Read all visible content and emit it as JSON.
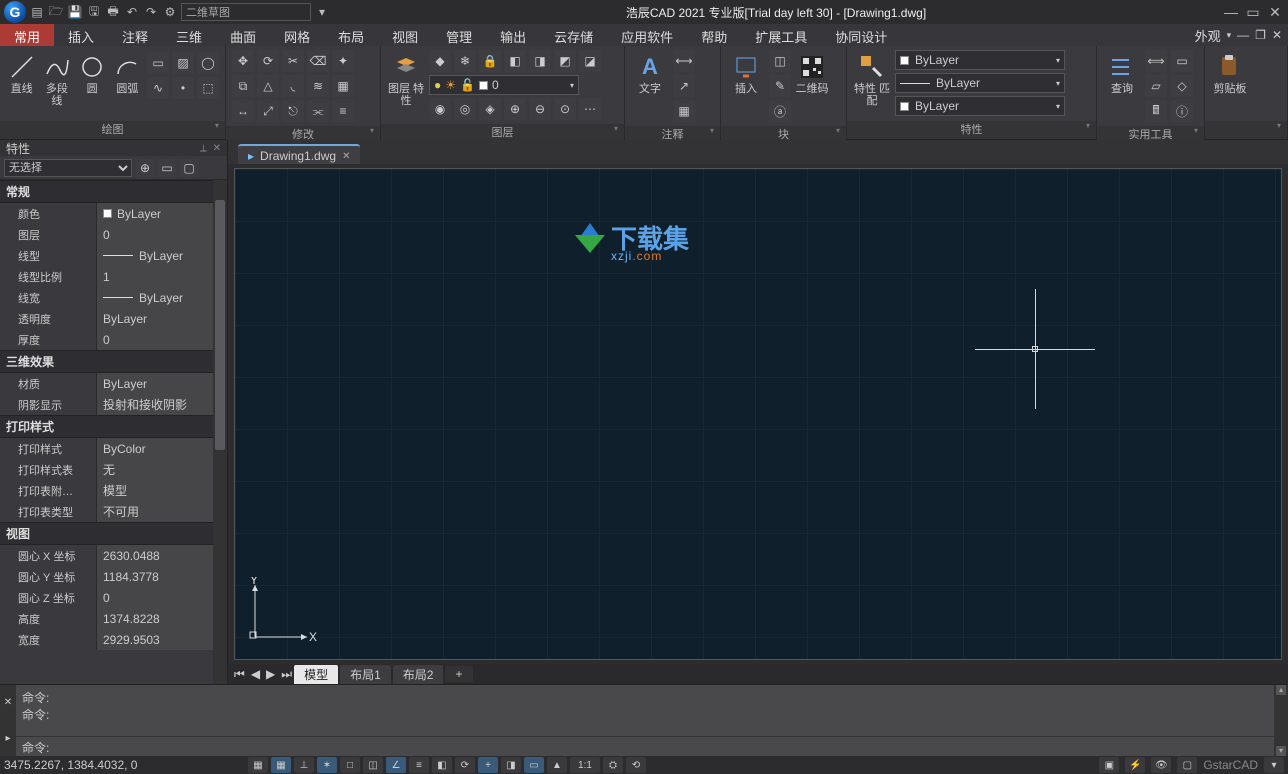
{
  "title": "浩辰CAD 2021 专业版[Trial day left 30] - [Drawing1.dwg]",
  "qat": {
    "workspace": "二维草图"
  },
  "menu": {
    "tabs": [
      "常用",
      "插入",
      "注释",
      "三维",
      "曲面",
      "网格",
      "布局",
      "视图",
      "管理",
      "输出",
      "云存储",
      "应用软件",
      "帮助",
      "扩展工具",
      "协同设计"
    ],
    "active": 0,
    "right_label": "外观"
  },
  "ribbon": {
    "draw": {
      "title": "绘图",
      "items": [
        "直线",
        "多段线",
        "圆",
        "圆弧"
      ]
    },
    "modify": {
      "title": "修改"
    },
    "layer": {
      "title": "图层",
      "big": "图层\n特性",
      "current": "0"
    },
    "annot": {
      "title": "注释",
      "big": "文字"
    },
    "block": {
      "title": "块",
      "big": "插入",
      "qr": "二维码"
    },
    "props": {
      "title": "特性",
      "big": "特性\n匹配",
      "color": "ByLayer",
      "lw": "ByLayer",
      "lt": "ByLayer"
    },
    "util": {
      "title": "实用工具",
      "big": "查询"
    },
    "clip": {
      "title": "剪贴板"
    }
  },
  "doc": {
    "tab": "Drawing1.dwg"
  },
  "watermark": {
    "line1": "下载集",
    "line2a": "xzji",
    "line2b": ".com"
  },
  "layouts": {
    "model": "模型",
    "l1": "布局1",
    "l2": "布局2",
    "plus": "+"
  },
  "properties": {
    "panel_title": "特性",
    "sel": "无选择",
    "cats": [
      {
        "name": "常规",
        "rows": [
          {
            "k": "颜色",
            "v": "ByLayer",
            "sw": "#fff"
          },
          {
            "k": "图层",
            "v": "0"
          },
          {
            "k": "线型",
            "v": "ByLayer",
            "ln": true
          },
          {
            "k": "线型比例",
            "v": "1"
          },
          {
            "k": "线宽",
            "v": "ByLayer",
            "ln": true
          },
          {
            "k": "透明度",
            "v": "ByLayer"
          },
          {
            "k": "厚度",
            "v": "0"
          }
        ]
      },
      {
        "name": "三维效果",
        "rows": [
          {
            "k": "材质",
            "v": "ByLayer"
          },
          {
            "k": "阴影显示",
            "v": "投射和接收阴影"
          }
        ]
      },
      {
        "name": "打印样式",
        "rows": [
          {
            "k": "打印样式",
            "v": "ByColor"
          },
          {
            "k": "打印样式表",
            "v": "无"
          },
          {
            "k": "打印表附…",
            "v": "模型"
          },
          {
            "k": "打印表类型",
            "v": "不可用"
          }
        ]
      },
      {
        "name": "视图",
        "rows": [
          {
            "k": "圆心 X 坐标",
            "v": "2630.0488"
          },
          {
            "k": "圆心 Y 坐标",
            "v": "1184.3778"
          },
          {
            "k": "圆心 Z 坐标",
            "v": "0"
          },
          {
            "k": "高度",
            "v": "1374.8228"
          },
          {
            "k": "宽度",
            "v": "2929.9503"
          }
        ]
      }
    ]
  },
  "cmd": {
    "prompt": "命令:",
    "history": [
      "命令:",
      "命令:"
    ]
  },
  "status": {
    "coords": "3475.2267, 1384.4032, 0",
    "scale": "1:1",
    "brand": "GstarCAD"
  }
}
